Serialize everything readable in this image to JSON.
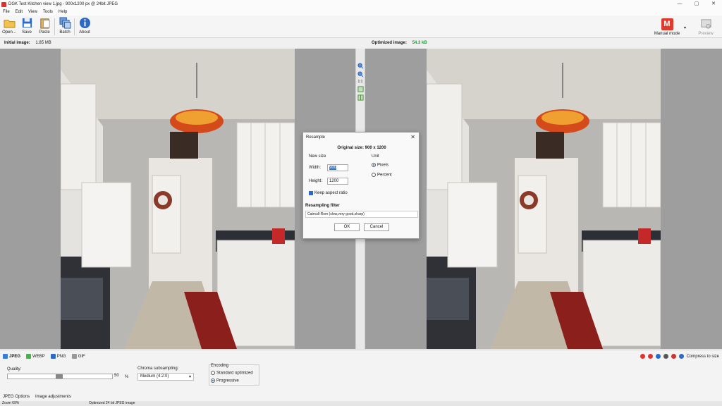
{
  "window": {
    "title": "DGK Test Kitchen view 1.jpg - 900x1200 px @ 24bit JPEG",
    "controls": [
      "—",
      "▢",
      "✕"
    ]
  },
  "menu": [
    "File",
    "Edit",
    "View",
    "Tools",
    "Help"
  ],
  "toolbar": {
    "open": "Open...",
    "save": "Save",
    "paste": "Paste",
    "batch": "Batch",
    "about": "About",
    "manual_mode": "Manual mode",
    "manual_letter": "M",
    "preview": "Preview"
  },
  "info": {
    "initial_label": "Initial image:",
    "initial_size": "1.85 MB",
    "optimized_label": "Optimized image:",
    "optimized_size": "54.3 kB"
  },
  "zoom_strip": {
    "ratio": "1:1"
  },
  "dialog": {
    "title": "Resample",
    "original_size": "Original size: 900 x 1200",
    "new_size": "New size",
    "width_label": "Width:",
    "width_value": "900",
    "height_label": "Height:",
    "height_value": "1200",
    "unit_label": "Unit",
    "pixels": "Pixels",
    "percent": "Percent",
    "keep_aspect": "Keep aspect ratio",
    "filter_label": "Resampling filter",
    "filter_value": "Catmull-Rom (slow,very good,sharp)",
    "ok": "OK",
    "cancel": "Cancel"
  },
  "formats": [
    "JPEG",
    "WEBP",
    "PNG",
    "GIF"
  ],
  "right_tools": {
    "compress": "Compress to size"
  },
  "jpeg": {
    "quality_label": "Quality:",
    "quality_value": "50",
    "quality_unit": "%",
    "chroma_label": "Chroma subsampling:",
    "chroma_value": "Medium (4:2:0)",
    "encoding_label": "Encoding",
    "standard": "Standard optimized",
    "progressive": "Progressive"
  },
  "option_tabs": [
    "JPEG Options",
    "Image adjustments"
  ],
  "status": {
    "zoom": "Zoom 69%",
    "output": "Optimized 24 bit JPEG image"
  },
  "colors": {
    "accent": "#1a5fb4",
    "green": "#19a02f",
    "manual": "#e03a2a"
  }
}
